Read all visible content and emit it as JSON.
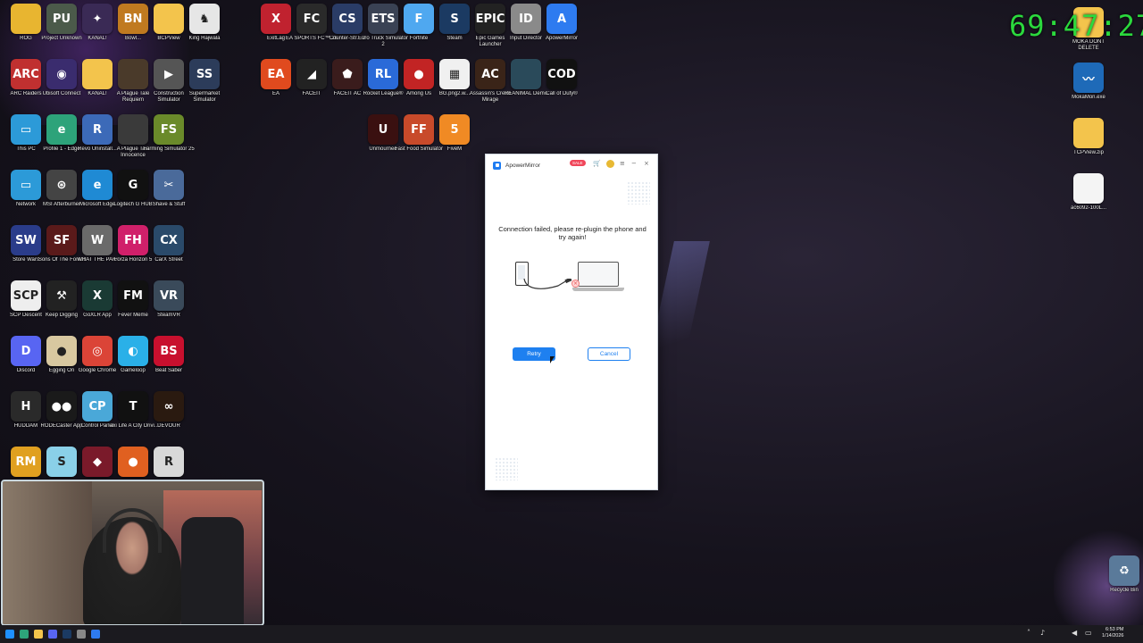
{
  "timer": "69:47:27",
  "desktop_icons": [
    {
      "id": "rog",
      "label": "ROG",
      "glyph": "",
      "color": "#e8b530"
    },
    {
      "id": "project-unknown",
      "label": "Project Unknown",
      "glyph": "PU",
      "color": "#4b5a4a"
    },
    {
      "id": "kanal1",
      "label": "KANAL!",
      "glyph": "✦",
      "color": "#3a2a55"
    },
    {
      "id": "bowl",
      "label": "Bowl...",
      "glyph": "BN",
      "color": "#c07a20"
    },
    {
      "id": "bcpview",
      "label": "BCPView",
      "glyph": "",
      "color": "#f3c44c"
    },
    {
      "id": "king-hajwala",
      "label": "King Hajwala",
      "glyph": "♞",
      "color": "#e6e6e6"
    },
    {
      "id": "exitlag",
      "label": "ExitLag",
      "glyph": "X",
      "color": "#c0222f"
    },
    {
      "id": "ea-sports",
      "label": "EA SPORTS FC™ 26",
      "glyph": "FC",
      "color": "#2a2a2a"
    },
    {
      "id": "counter-strike",
      "label": "Counter-Str... 2",
      "glyph": "CS",
      "color": "#2a3c66"
    },
    {
      "id": "euro-truck",
      "label": "Euro Truck Simulator 2",
      "glyph": "ETS",
      "color": "#3a4254"
    },
    {
      "id": "fortnite",
      "label": "Fortnite",
      "glyph": "F",
      "color": "#4fa8f0"
    },
    {
      "id": "steam",
      "label": "Steam",
      "glyph": "S",
      "color": "#1b3a62"
    },
    {
      "id": "epic",
      "label": "Epic Games Launcher",
      "glyph": "EPIC",
      "color": "#222222"
    },
    {
      "id": "input-director",
      "label": "Input Director",
      "glyph": "ID",
      "color": "#8a8a8a"
    },
    {
      "id": "apowermirror-icon",
      "label": "ApowerMirror",
      "glyph": "A",
      "color": "#2e7bf0"
    },
    {
      "id": "arc-raiders",
      "label": "ARC Raiders",
      "glyph": "ARC",
      "color": "#c03030"
    },
    {
      "id": "ubisoft",
      "label": "Ubisoft Connect",
      "glyph": "◉",
      "color": "#3a2c6e"
    },
    {
      "id": "kanal2",
      "label": "KANAL!",
      "glyph": "",
      "color": "#f3c44c"
    },
    {
      "id": "plague-requiem",
      "label": "A Plague Tale Requiem",
      "glyph": "",
      "color": "#4a3a2a"
    },
    {
      "id": "construction-sim",
      "label": "Construction Simulator",
      "glyph": "▶",
      "color": "#555555"
    },
    {
      "id": "supermarket-sim",
      "label": "Supermarket Simulator",
      "glyph": "SS",
      "color": "#2c3c5a"
    },
    {
      "id": "ea",
      "label": "EA",
      "glyph": "EA",
      "color": "#e04a1e"
    },
    {
      "id": "faceit",
      "label": "FACEIT",
      "glyph": "◢",
      "color": "#222222"
    },
    {
      "id": "faceit-ac",
      "label": "FACEIT AC",
      "glyph": "⬟",
      "color": "#3a1c1c"
    },
    {
      "id": "rocket-league",
      "label": "Rocket League®",
      "glyph": "RL",
      "color": "#2a6ad8"
    },
    {
      "id": "among-us",
      "label": "Among Us",
      "glyph": "●",
      "color": "#c22424"
    },
    {
      "id": "bg-png",
      "label": "BG.png2.w...",
      "glyph": "▦",
      "color": "#f0f0f0"
    },
    {
      "id": "ac-mirage",
      "label": "Assassin's Creed Mirage",
      "glyph": "AC",
      "color": "#3a2418"
    },
    {
      "id": "reanimal",
      "label": "REANIMAL Demo",
      "glyph": "",
      "color": "#2a4a5a"
    },
    {
      "id": "cod",
      "label": "Call of Duty®",
      "glyph": "COD",
      "color": "#111111"
    },
    {
      "id": "this-pc",
      "label": "This PC",
      "glyph": "▭",
      "color": "#2c9ad8"
    },
    {
      "id": "profile1-edge",
      "label": "Profile 1 - Edge",
      "glyph": "e",
      "color": "#2da37a"
    },
    {
      "id": "revo",
      "label": "Revo Uninstall...",
      "glyph": "R",
      "color": "#3c6ab8"
    },
    {
      "id": "plague-innocence",
      "label": "A Plague Tale Innocence",
      "glyph": "",
      "color": "#3a3a3a"
    },
    {
      "id": "farming-sim",
      "label": "Farming Simulator 25",
      "glyph": "FS",
      "color": "#6a8a2a"
    },
    {
      "id": "unmourned",
      "label": "Unmourned",
      "glyph": "U",
      "color": "#3a1010"
    },
    {
      "id": "fast-food",
      "label": "Fast Food Simulator",
      "glyph": "FF",
      "color": "#c84a2a"
    },
    {
      "id": "fivem",
      "label": "FiveM",
      "glyph": "5",
      "color": "#f08a24"
    },
    {
      "id": "network",
      "label": "Network",
      "glyph": "▭",
      "color": "#2c9ad8"
    },
    {
      "id": "msi",
      "label": "MSI Afterburner",
      "glyph": "⊛",
      "color": "#444444"
    },
    {
      "id": "ms-edge",
      "label": "Microsoft Edge",
      "glyph": "e",
      "color": "#1f8ad4"
    },
    {
      "id": "logitech",
      "label": "Logitech G HUB",
      "glyph": "G",
      "color": "#111111"
    },
    {
      "id": "shave-stuff",
      "label": "Shave & Stuff",
      "glyph": "✂",
      "color": "#4a6a9a"
    },
    {
      "id": "store-wars",
      "label": "Store Wars",
      "glyph": "SW",
      "color": "#2a3c8a"
    },
    {
      "id": "sons-forest",
      "label": "Sons Of The Forest",
      "glyph": "SF",
      "color": "#5a1a1a"
    },
    {
      "id": "what-the-pak",
      "label": "WHAT THE PAK!",
      "glyph": "W",
      "color": "#6a6a6a"
    },
    {
      "id": "forza",
      "label": "Forza Horizon 5",
      "glyph": "FH",
      "color": "#d0206a"
    },
    {
      "id": "carx",
      "label": "CarX Street",
      "glyph": "CX",
      "color": "#2a4a6a"
    },
    {
      "id": "scp",
      "label": "SCP Descent",
      "glyph": "SCP",
      "color": "#eeeeee"
    },
    {
      "id": "keep-digging",
      "label": "Keep Digging",
      "glyph": "⚒",
      "color": "#222222"
    },
    {
      "id": "goxlr",
      "label": "GoXLR App",
      "glyph": "X",
      "color": "#1a3a34"
    },
    {
      "id": "fever-meme",
      "label": "Fever Meme",
      "glyph": "FM",
      "color": "#111111"
    },
    {
      "id": "steamvr",
      "label": "SteamVR",
      "glyph": "VR",
      "color": "#3a4a5a"
    },
    {
      "id": "discord",
      "label": "Discord",
      "glyph": "D",
      "color": "#5865f2"
    },
    {
      "id": "egging-on",
      "label": "Egging On",
      "glyph": "●",
      "color": "#d8c8a0"
    },
    {
      "id": "chrome",
      "label": "Google Chrome",
      "glyph": "◎",
      "color": "#db4437"
    },
    {
      "id": "gamaloop",
      "label": "Gameloop",
      "glyph": "◐",
      "color": "#2ab0e8"
    },
    {
      "id": "beat-saber",
      "label": "Beat Saber",
      "glyph": "BS",
      "color": "#c8102e"
    },
    {
      "id": "hudda",
      "label": "HUDDAM",
      "glyph": "H",
      "color": "#2a2a2a"
    },
    {
      "id": "rodecaster",
      "label": "RODECaster App",
      "glyph": "●●",
      "color": "#1a1a1a"
    },
    {
      "id": "control-panel",
      "label": "Control Panel",
      "glyph": "CP",
      "color": "#4aa8d8"
    },
    {
      "id": "taxi-life",
      "label": "Taxi Life A City Drivi...",
      "glyph": "T",
      "color": "#111111"
    },
    {
      "id": "devour",
      "label": "DEVOUR",
      "glyph": "∞",
      "color": "#2a1a10"
    },
    {
      "id": "bottom-1",
      "label": "",
      "glyph": "RM",
      "color": "#e0a020"
    },
    {
      "id": "bottom-2",
      "label": "",
      "glyph": "S",
      "color": "#8ad0e8"
    },
    {
      "id": "bottom-3",
      "label": "",
      "glyph": "◆",
      "color": "#7a1a2a"
    },
    {
      "id": "bottom-4",
      "label": "",
      "glyph": "●",
      "color": "#e06020"
    },
    {
      "id": "bottom-5",
      "label": "",
      "glyph": "R",
      "color": "#d8d8d8"
    },
    {
      "id": "moka-dont-delete",
      "label": "MOKA DONT DELETE",
      "glyph": "",
      "color": "#f3c44c"
    },
    {
      "id": "mokamon",
      "label": "MokaMon.exe",
      "glyph": "〰",
      "color": "#1e6ab8"
    },
    {
      "id": "tcpview-zip",
      "label": "TCPView.zip",
      "glyph": "",
      "color": "#f3c44c"
    },
    {
      "id": "ac6092",
      "label": "ac6092-100L...",
      "glyph": "",
      "color": "#f4f4f4"
    },
    {
      "id": "recycle-bin",
      "label": "Recycle Bin",
      "glyph": "♻",
      "color": "#5a7a9a"
    }
  ],
  "app": {
    "title": "ApowerMirror",
    "sale_badge": "SALE",
    "message": "Connection failed, please re-plugin the phone and try again!",
    "retry_label": "Retry",
    "cancel_label": "Cancel"
  },
  "tray": {
    "time": "6:53 PM",
    "date": "1/14/2026"
  }
}
